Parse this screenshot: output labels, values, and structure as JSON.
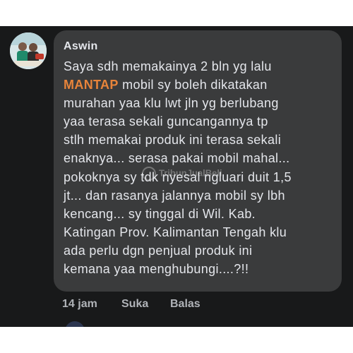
{
  "comment": {
    "author": "Aswin",
    "lines": [
      "Saya sdh memakainya 2 bln yg lalu",
      "mobil sy boleh dikatakan",
      "murahan yaa klu lwt jln yg berlubang",
      "yaa terasa sekali guncangannya tp",
      "stlh memakai produk ini terasa sekali",
      "enaknya... serasa pakai mobil mahal...",
      "pokoknya sy tdk nyesal ngluari duit 1,5",
      "jt... dan rasanya jalannya mobil sy lbh",
      "kencang... sy tinggal di Wil. Kab.",
      "Katingan Prov. Kalimantan Tengah klu",
      "ada perlu dgn penjual produk ini",
      "kemana yaa menghubungi....?!!"
    ],
    "highlight": "MANTAP",
    "time": "14 jam",
    "like_label": "Suka",
    "reply_label": "Balas"
  },
  "watermark": "TribunJualBeli",
  "colors": {
    "background": "#18191a",
    "bubble": "#3a3b3c",
    "text": "#e4e6eb",
    "highlight": "#e8843a",
    "secondary": "#b0b3b8"
  }
}
